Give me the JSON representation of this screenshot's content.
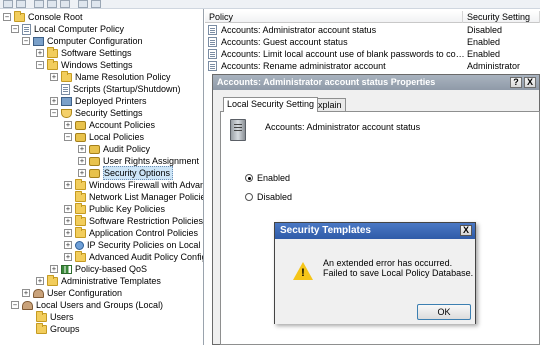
{
  "toolbar": {
    "buttons": [
      "back",
      "forward",
      "up",
      "show-hide-tree",
      "properties",
      "help",
      "export-list"
    ]
  },
  "tree": {
    "items": [
      {
        "label": "Console Root",
        "icon": "folder-icon",
        "expander": "−"
      },
      {
        "label": "Local Computer Policy",
        "icon": "policy-icon",
        "expander": "−"
      },
      {
        "label": "Computer Configuration",
        "icon": "computer-icon",
        "expander": "−"
      },
      {
        "label": "Software Settings",
        "icon": "folder-icon",
        "expander": "+"
      },
      {
        "label": "Windows Settings",
        "icon": "folder-icon",
        "expander": "−"
      },
      {
        "label": "Name Resolution Policy",
        "icon": "folder-icon",
        "expander": "+"
      },
      {
        "label": "Scripts (Startup/Shutdown)",
        "icon": "script-icon",
        "expander": ""
      },
      {
        "label": "Deployed Printers",
        "icon": "printer-icon",
        "expander": "+"
      },
      {
        "label": "Security Settings",
        "icon": "shield-icon",
        "expander": "−"
      },
      {
        "label": "Account Policies",
        "icon": "folder-icon",
        "expander": "+"
      },
      {
        "label": "Local Policies",
        "icon": "folder-icon",
        "expander": "−"
      },
      {
        "label": "Audit Policy",
        "icon": "folder-icon",
        "expander": "+"
      },
      {
        "label": "User Rights Assignment",
        "icon": "folder-icon",
        "expander": "+"
      },
      {
        "label": "Security Options",
        "icon": "folder-icon",
        "expander": "+"
      },
      {
        "label": "Windows Firewall with Advance",
        "icon": "folder-icon",
        "expander": "+"
      },
      {
        "label": "Network List Manager Policies",
        "icon": "folder-icon",
        "expander": ""
      },
      {
        "label": "Public Key Policies",
        "icon": "folder-icon",
        "expander": "+"
      },
      {
        "label": "Software Restriction Policies",
        "icon": "folder-icon",
        "expander": "+"
      },
      {
        "label": "Application Control Policies",
        "icon": "folder-icon",
        "expander": "+"
      },
      {
        "label": "IP Security Policies on Local Co",
        "icon": "globe-icon",
        "expander": "+"
      },
      {
        "label": "Advanced Audit Policy Configu",
        "icon": "folder-icon",
        "expander": "+"
      },
      {
        "label": "Policy-based QoS",
        "icon": "qos-icon",
        "expander": "+"
      },
      {
        "label": "Administrative Templates",
        "icon": "folder-icon",
        "expander": "+"
      },
      {
        "label": "User Configuration",
        "icon": "user-icon",
        "expander": "+"
      },
      {
        "label": "Local Users and Groups (Local)",
        "icon": "users-icon",
        "expander": "−"
      },
      {
        "label": "Users",
        "icon": "folder-icon",
        "expander": ""
      },
      {
        "label": "Groups",
        "icon": "folder-icon",
        "expander": ""
      }
    ],
    "selected": "Security Options"
  },
  "list": {
    "columns": [
      "Policy",
      "Security Setting"
    ],
    "rows": [
      {
        "policy": "Accounts: Administrator account status",
        "setting": "Disabled"
      },
      {
        "policy": "Accounts: Guest account status",
        "setting": "Enabled"
      },
      {
        "policy": "Accounts: Limit local account use of blank passwords to console l...",
        "setting": "Enabled"
      },
      {
        "policy": "Accounts: Rename administrator account",
        "setting": "Administrator"
      }
    ]
  },
  "properties": {
    "title": "Accounts: Administrator account status Properties",
    "help_btn": "?",
    "close_btn": "X",
    "tabs": [
      "Local Security Setting",
      "Explain"
    ],
    "policy_name": "Accounts: Administrator account status",
    "options": [
      {
        "label": "Enabled",
        "checked": true
      },
      {
        "label": "Disabled",
        "checked": false
      }
    ]
  },
  "error_dialog": {
    "title": "Security Templates",
    "close_btn": "X",
    "icon": "warning-icon",
    "line1": "An extended error has occurred.",
    "line2": "Failed to save Local Policy Database.",
    "ok_label": "OK"
  },
  "colors": {
    "error_title_bar": "#2f5ba8",
    "props_title_bar": "#8f9aa8",
    "selection": "#cde5f7",
    "warning": "#f5c518"
  }
}
